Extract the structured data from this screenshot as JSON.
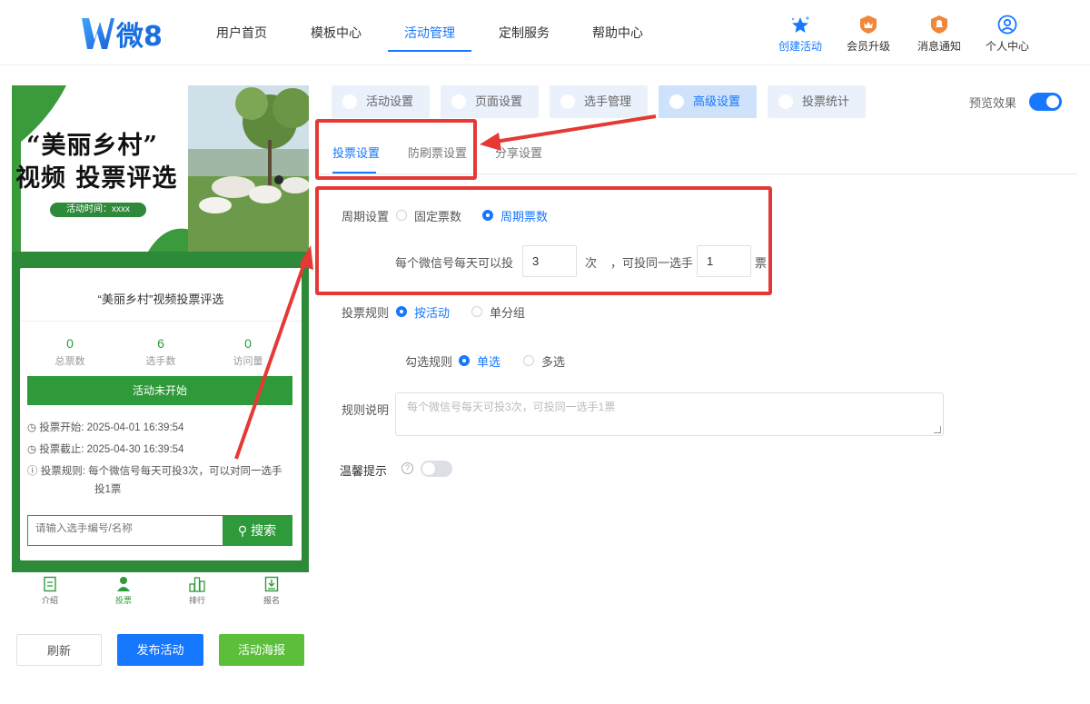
{
  "header": {
    "logo_text": "微8",
    "nav": [
      "用户首页",
      "模板中心",
      "活动管理",
      "定制服务",
      "帮助中心"
    ],
    "actions": {
      "create": "创建活动",
      "upgrade": "会员升级",
      "notify": "消息通知",
      "profile": "个人中心"
    }
  },
  "preview": {
    "banner": {
      "line1": "“美丽乡村”",
      "line2": "视频 投票评选",
      "time": "活动时间：xxxx"
    },
    "card_title": "“美丽乡村”视频投票评选",
    "stats": [
      {
        "num": "0",
        "label": "总票数"
      },
      {
        "num": "6",
        "label": "选手数"
      },
      {
        "num": "0",
        "label": "访问量"
      }
    ],
    "status": "活动未开始",
    "vote_start_label": "投票开始:",
    "vote_start": "2025-04-01 16:39:54",
    "vote_end_label": "投票截止:",
    "vote_end": "2025-04-30 16:39:54",
    "rule_label": "投票规则:",
    "rule_line1": "每个微信号每天可投3次，可以对同一选手",
    "rule_line2": "投1票",
    "search_placeholder": "请输入选手编号/名称",
    "search_button": "搜索",
    "bottom_nav": [
      "介绍",
      "投票",
      "排行",
      "报名"
    ]
  },
  "buttons": {
    "refresh": "刷新",
    "publish": "发布活动",
    "poster": "活动海报"
  },
  "top_tabs": [
    "活动设置",
    "页面设置",
    "选手管理",
    "高级设置",
    "投票统计"
  ],
  "preview_toggle_label": "预览效果",
  "sub_tabs": [
    "投票设置",
    "防刷票设置",
    "分享设置"
  ],
  "form": {
    "cycle_label": "周期设置",
    "cycle_fixed": "固定票数",
    "cycle_period": "周期票数",
    "per_day_prefix": "每个微信号每天可以投",
    "per_day_value": "3",
    "per_day_unit": "次",
    "same_player_prefix": "，可投同一选手",
    "same_player_value": "1",
    "same_player_unit": "票",
    "rule_label": "投票规则",
    "rule_by_activity": "按活动",
    "rule_by_group": "单分组",
    "check_label": "勾选规则",
    "check_single": "单选",
    "check_multi": "多选",
    "desc_label": "规则说明",
    "desc_placeholder": "每个微信号每天可投3次，可投同一选手1票",
    "tip_label": "温馨提示",
    "tip_help": "?"
  },
  "colors": {
    "accent": "#1677ff",
    "green": "#2e9a3a",
    "annotation_red": "#e53935"
  }
}
